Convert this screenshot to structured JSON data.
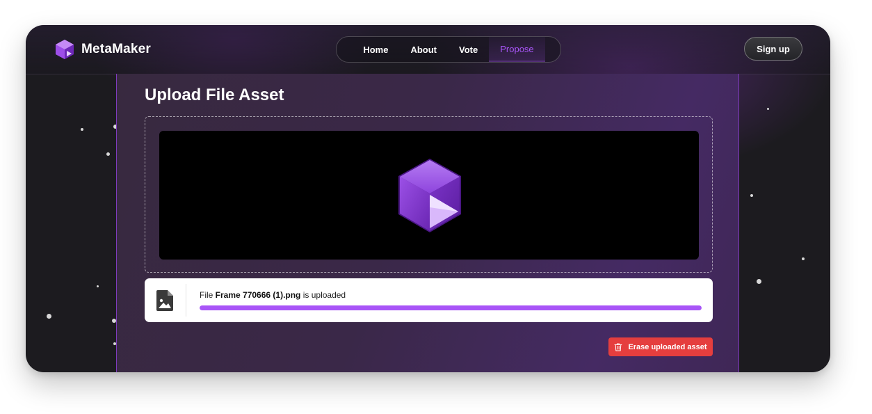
{
  "header": {
    "brand": "MetaMaker",
    "nav": [
      "Home",
      "About",
      "Vote",
      "Propose"
    ],
    "active_nav": "Propose",
    "signup_label": "Sign up"
  },
  "main": {
    "title": "Upload File Asset",
    "upload": {
      "prefix": "File ",
      "filename": "Frame 770666 (1).png",
      "suffix": " is uploaded",
      "progress": 1.0
    },
    "erase_label": "Erase uploaded asset"
  },
  "colors": {
    "accent": "#a855f7",
    "danger": "#e53e3e",
    "background": "#1c1b1f"
  },
  "icons": [
    "cube-logo-icon",
    "image-file-icon",
    "trash-icon"
  ]
}
